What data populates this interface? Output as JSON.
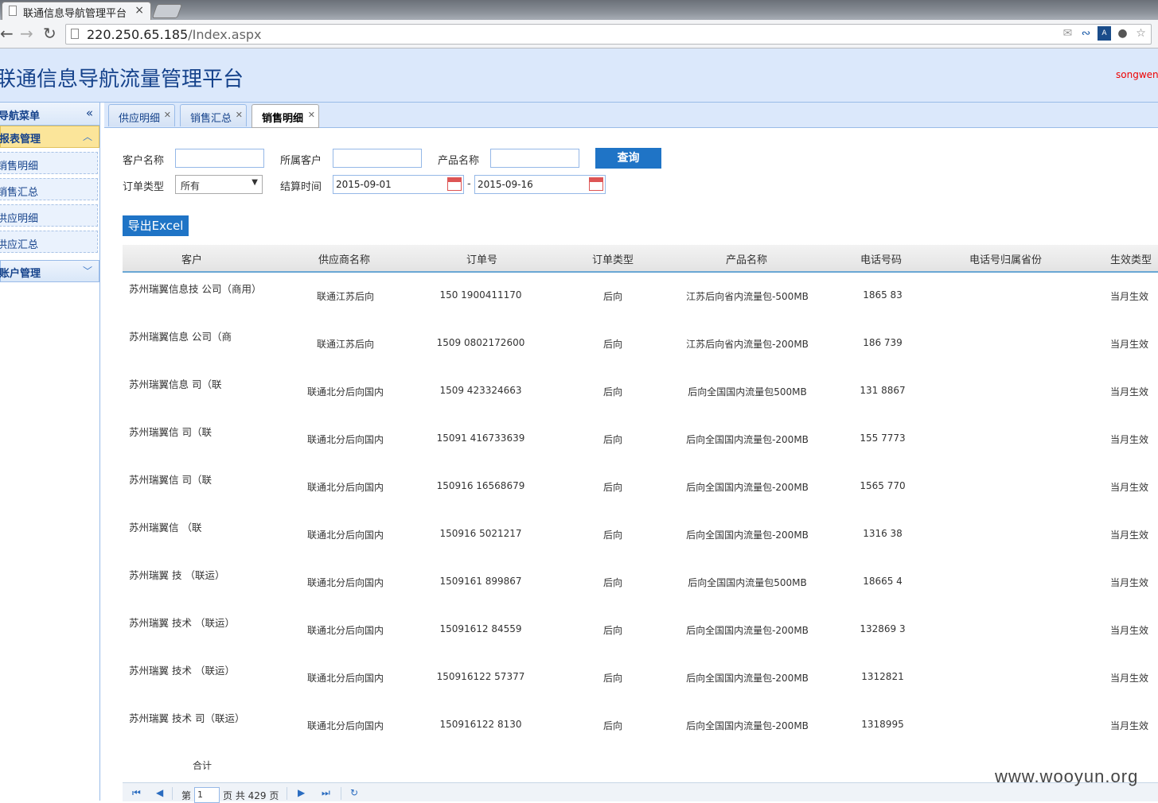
{
  "browser": {
    "tab_title": "联通信息导航管理平台",
    "url_host": "220.250.65.185",
    "url_path": "/Index.aspx"
  },
  "app": {
    "title": "联通信息导航流量管理平台",
    "user": "songwenj"
  },
  "sidebar": {
    "header": "导航菜单",
    "groups": [
      {
        "label": "报表管理",
        "items": [
          "销售明细",
          "销售汇总",
          "供应明细",
          "供应汇总"
        ]
      },
      {
        "label": "账户管理"
      }
    ]
  },
  "tabs": [
    {
      "label": "供应明细"
    },
    {
      "label": "销售汇总"
    },
    {
      "label": "销售明细"
    }
  ],
  "form": {
    "customer_label": "客户名称",
    "parent_label": "所属客户",
    "product_label": "产品名称",
    "query_button": "查询",
    "order_type_label": "订单类型",
    "order_type_value": "所有",
    "settle_label": "结算时间",
    "date_from": "2015-09-01",
    "date_sep": "-",
    "date_to": "2015-09-16",
    "export_button": "导出Excel"
  },
  "table": {
    "columns": [
      "客户",
      "供应商名称",
      "订单号",
      "订单类型",
      "产品名称",
      "电话号码",
      "电话号归属省份",
      "生效类型"
    ],
    "rows": [
      {
        "customer": "苏州瑞翼信息技 公司（商用）",
        "supplier": "联通江苏后向",
        "order": "150 1900411170",
        "type": "后向",
        "product": "江苏后向省内流量包-500MB",
        "phone": "1865 83",
        "province": "",
        "effect": "当月生效"
      },
      {
        "customer": "苏州瑞翼信息 公司（商",
        "supplier": "联通江苏后向",
        "order": "1509 0802172600",
        "type": "后向",
        "product": "江苏后向省内流量包-200MB",
        "phone": "186 739",
        "province": "",
        "effect": "当月生效"
      },
      {
        "customer": "苏州瑞翼信息 司（联",
        "supplier": "联通北分后向国内",
        "order": "1509 423324663",
        "type": "后向",
        "product": "后向全国国内流量包500MB",
        "phone": "131 8867",
        "province": "",
        "effect": "当月生效"
      },
      {
        "customer": "苏州瑞翼信 司（联",
        "supplier": "联通北分后向国内",
        "order": "15091 416733639",
        "type": "后向",
        "product": "后向全国国内流量包-200MB",
        "phone": "155 7773",
        "province": "",
        "effect": "当月生效"
      },
      {
        "customer": "苏州瑞翼信 司（联",
        "supplier": "联通北分后向国内",
        "order": "150916 16568679",
        "type": "后向",
        "product": "后向全国国内流量包-200MB",
        "phone": "1565 770",
        "province": "",
        "effect": "当月生效"
      },
      {
        "customer": "苏州瑞翼信 （联",
        "supplier": "联通北分后向国内",
        "order": "150916 5021217",
        "type": "后向",
        "product": "后向全国国内流量包-200MB",
        "phone": "1316 38",
        "province": "",
        "effect": "当月生效"
      },
      {
        "customer": "苏州瑞翼 技 （联运）",
        "supplier": "联通北分后向国内",
        "order": "1509161 899867",
        "type": "后向",
        "product": "后向全国国内流量包500MB",
        "phone": "18665 4",
        "province": "",
        "effect": "当月生效"
      },
      {
        "customer": "苏州瑞翼 技术 （联运）",
        "supplier": "联通北分后向国内",
        "order": "15091612 84559",
        "type": "后向",
        "product": "后向全国国内流量包-200MB",
        "phone": "132869 3",
        "province": "",
        "effect": "当月生效"
      },
      {
        "customer": "苏州瑞翼 技术 （联运）",
        "supplier": "联通北分后向国内",
        "order": "150916122 57377",
        "type": "后向",
        "product": "后向全国国内流量包-200MB",
        "phone": "1312821",
        "province": "",
        "effect": "当月生效"
      },
      {
        "customer": "苏州瑞翼 技术 司（联运）",
        "supplier": "联通北分后向国内",
        "order": "150916122 8130",
        "type": "后向",
        "product": "后向全国国内流量包-200MB",
        "phone": "1318995",
        "province": "",
        "effect": "当月生效"
      }
    ],
    "summary_label": "合计"
  },
  "pager": {
    "page_prefix": "第",
    "page_value": "1",
    "page_suffix": "页 共 429 页"
  },
  "watermark": "www.wooyun.org",
  "colors": {
    "accent": "#1f74c6",
    "header_bg": "#dbe8fb",
    "user": "#ee0000",
    "active_group": "#fbe59a"
  }
}
